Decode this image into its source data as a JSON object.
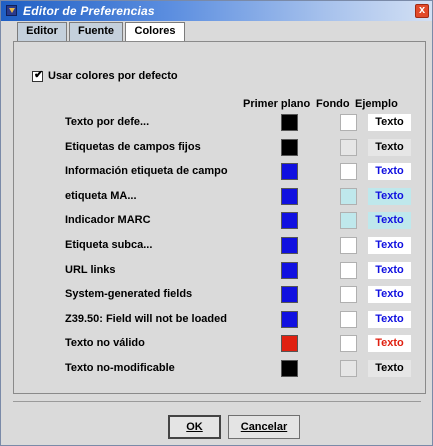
{
  "window": {
    "title": "Editor de Preferencias",
    "close_glyph": "x"
  },
  "tabs": [
    {
      "label": "Editor",
      "active": false
    },
    {
      "label": "Fuente",
      "active": false
    },
    {
      "label": "Colores",
      "active": true
    }
  ],
  "defaults_checkbox": {
    "label": "Usar colores por defecto",
    "checked": true,
    "mark": "✔"
  },
  "columns": {
    "foreground": "Primer plano",
    "background": "Fondo",
    "example": "Ejemplo"
  },
  "rows": [
    {
      "label": "Texto por defe...",
      "fg": "#000000",
      "bg": "#ffffff",
      "example": "Texto",
      "example_color": "#000000"
    },
    {
      "label": "Etiquetas de campos fijos",
      "fg": "#000000",
      "bg": "#e6e6e6",
      "example": "Texto",
      "example_color": "#000000"
    },
    {
      "label": "Información etiqueta de campo",
      "fg": "#1010e0",
      "bg": "#ffffff",
      "example": "Texto",
      "example_color": "#1010e0"
    },
    {
      "label": "etiqueta MA...",
      "fg": "#1010e0",
      "bg": "#bfe8ec",
      "example": "Texto",
      "example_color": "#1010e0"
    },
    {
      "label": "Indicador MARC",
      "fg": "#1010e0",
      "bg": "#bfe8ec",
      "example": "Texto",
      "example_color": "#1010e0"
    },
    {
      "label": "Etiqueta subca...",
      "fg": "#1010e0",
      "bg": "#ffffff",
      "example": "Texto",
      "example_color": "#1010e0"
    },
    {
      "label": "URL links",
      "fg": "#1010e0",
      "bg": "#ffffff",
      "example": "Texto",
      "example_color": "#1010e0"
    },
    {
      "label": "System-generated fields",
      "fg": "#1010e0",
      "bg": "#ffffff",
      "example": "Texto",
      "example_color": "#1010e0"
    },
    {
      "label": "Z39.50: Field will not be loaded",
      "fg": "#1010e0",
      "bg": "#ffffff",
      "example": "Texto",
      "example_color": "#1010e0"
    },
    {
      "label": "Texto no válido",
      "fg": "#e02010",
      "bg": "#ffffff",
      "example": "Texto",
      "example_color": "#e02010"
    },
    {
      "label": "Texto no-modificable",
      "fg": "#000000",
      "bg": "#e6e6e6",
      "example": "Texto",
      "example_color": "#000000"
    }
  ],
  "buttons": {
    "ok": "OK",
    "cancel": "Cancelar"
  }
}
